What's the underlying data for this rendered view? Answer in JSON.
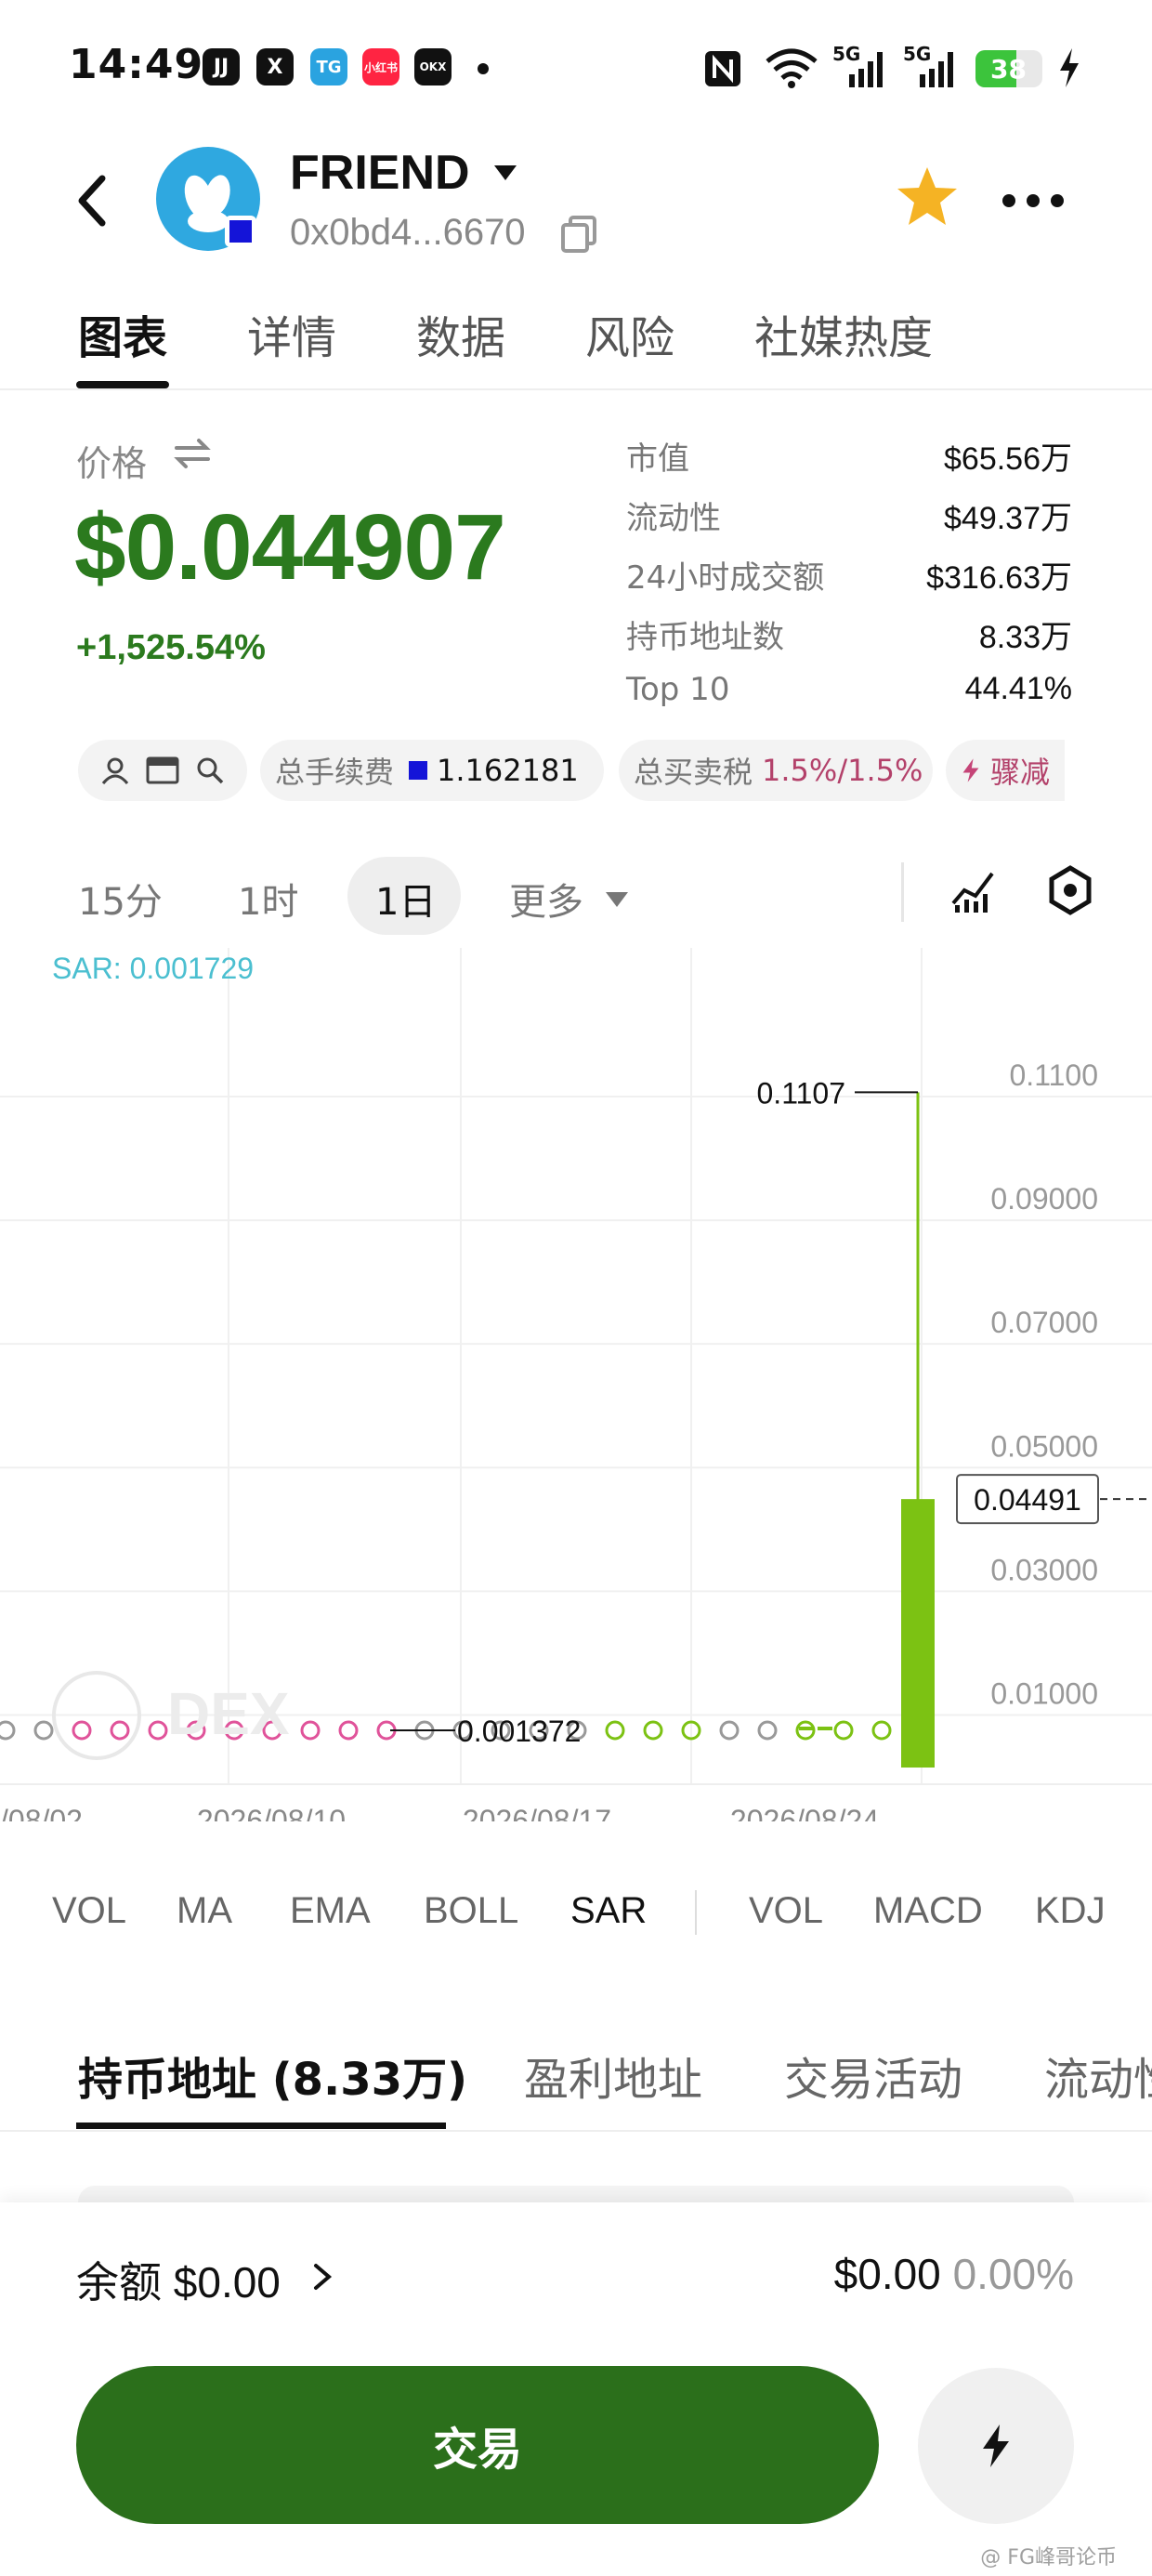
{
  "status_bar": {
    "time": "14:49",
    "apps": [
      "JJ",
      "X",
      "TG",
      "小红书",
      "OKX"
    ],
    "network_1": "5G",
    "network_2": "5G",
    "battery": "38"
  },
  "header": {
    "token_name": "FRIEND",
    "token_address": "0x0bd4...6670",
    "icons": [
      "back-arrow-icon",
      "dropdown-caret-icon",
      "copy-icon",
      "star-icon",
      "more-icon"
    ],
    "star_color": "#f5b324"
  },
  "tabs": [
    {
      "label": "图表",
      "active": true
    },
    {
      "label": "详情"
    },
    {
      "label": "数据"
    },
    {
      "label": "风险"
    },
    {
      "label": "社媒热度"
    }
  ],
  "price": {
    "label": "价格",
    "value": "$0.044907",
    "change": "+1,525.54%",
    "color": "#2b7a1e"
  },
  "stats": [
    {
      "label": "市值",
      "value": "$65.56万"
    },
    {
      "label": "流动性",
      "value": "$49.37万"
    },
    {
      "label": "24小时成交额",
      "value": "$316.63万"
    },
    {
      "label": "持币地址数",
      "value": "8.33万"
    },
    {
      "label": "Top 10",
      "value": "44.41%"
    }
  ],
  "chips": {
    "fee_label": "总手续费",
    "fee_value": "1.162181",
    "tax_label": "总买卖税",
    "tax_value": "1.5%/1.5%",
    "burn_label": "骤减"
  },
  "intervals": [
    {
      "label": "15分"
    },
    {
      "label": "1时"
    },
    {
      "label": "1日",
      "active": true
    },
    {
      "label": "更多"
    }
  ],
  "chart_data": {
    "type": "candlestick",
    "indicator_label": "SAR: 0.001729",
    "y_ticks": [
      "0.1100",
      "0.09000",
      "0.07000",
      "0.05000",
      "0.03000",
      "0.01000"
    ],
    "y_tick_values": [
      0.11,
      0.09,
      0.07,
      0.05,
      0.03,
      0.01
    ],
    "x_ticks": [
      "/08/02",
      "2026/08/10",
      "2026/08/17",
      "2026/08/24"
    ],
    "high_label": "0.1107",
    "low_label": "0.001372",
    "current_price_label": "0.04491",
    "last_candle": {
      "open": 0.0015,
      "close": 0.04491,
      "high": 0.1107,
      "low": 0.0015
    },
    "sar_points_count": 25,
    "colors": {
      "up": "#7cc213",
      "sar_red": "#e0539a",
      "sar_green": "#7cc213",
      "sar_gray": "#999999"
    },
    "watermark": "DEX"
  },
  "indicators_main": [
    "VOL",
    "MA",
    "EMA",
    "BOLL",
    "SAR"
  ],
  "indicators_sub": [
    "VOL",
    "MACD",
    "KDJ"
  ],
  "active_indicator": "SAR",
  "bottom_tabs": [
    {
      "label": "持币地址 (8.33万)",
      "active": true
    },
    {
      "label": "盈利地址"
    },
    {
      "label": "交易活动"
    },
    {
      "label": "流动性"
    }
  ],
  "footer": {
    "balance_label": "余额",
    "balance_value": "$0.00",
    "right_value": "$0.00",
    "right_percent": "0.00%",
    "trade_label": "交易",
    "trade_color": "#2b6f1b"
  },
  "watermark_text": "@ FG峰哥论币"
}
